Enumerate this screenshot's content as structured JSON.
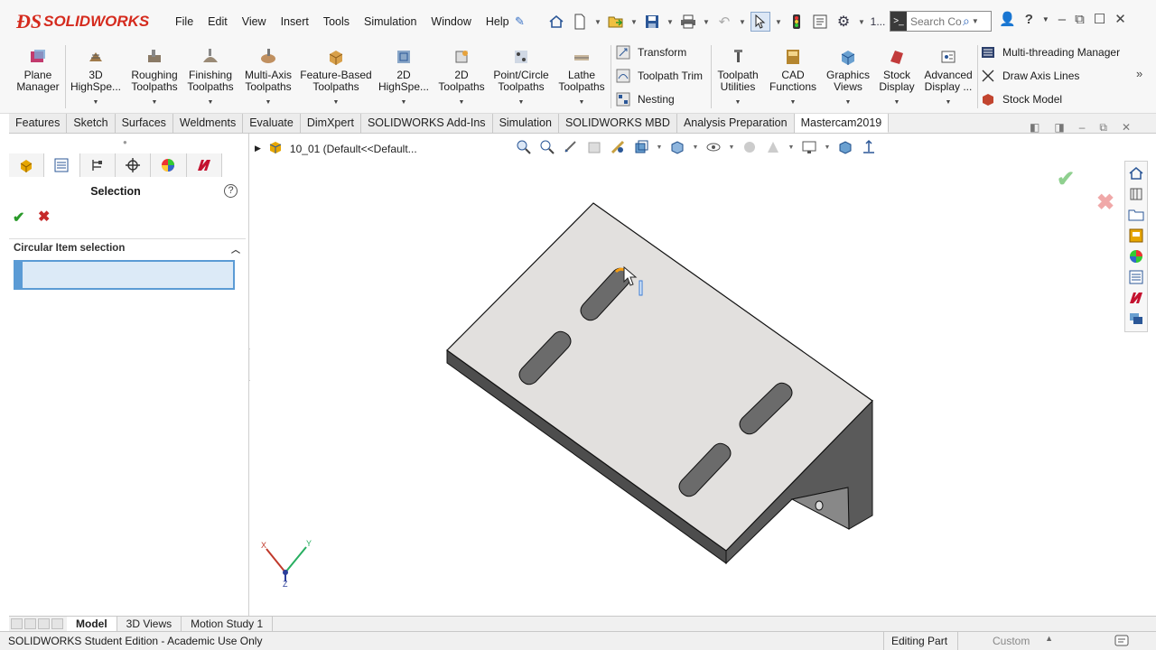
{
  "app": {
    "logo_text": "SOLIDWORKS",
    "menu": [
      "File",
      "Edit",
      "View",
      "Insert",
      "Tools",
      "Simulation",
      "Window",
      "Help"
    ],
    "search_placeholder": "Search Co",
    "rebuild_count": "1..."
  },
  "command_manager": {
    "plane_manager": "Plane Manager",
    "buttons": [
      {
        "label": "3D HighSpe...",
        "icon": "3d-highspeed-icon"
      },
      {
        "label": "Roughing Toolpaths",
        "icon": "roughing-icon"
      },
      {
        "label": "Finishing Toolpaths",
        "icon": "finishing-icon"
      },
      {
        "label": "Multi-Axis Toolpaths",
        "icon": "multiaxis-icon"
      },
      {
        "label": "Feature-Based Toolpaths",
        "icon": "feature-based-icon"
      },
      {
        "label": "2D HighSpe...",
        "icon": "2d-highspeed-icon"
      },
      {
        "label": "2D Toolpaths",
        "icon": "2d-toolpaths-icon"
      },
      {
        "label": "Point/Circle Toolpaths",
        "icon": "point-circle-icon"
      },
      {
        "label": "Lathe Toolpaths",
        "icon": "lathe-icon"
      }
    ],
    "stack": [
      "Transform",
      "Toolpath Trim",
      "Nesting"
    ],
    "buttons2": [
      {
        "label": "Toolpath Utilities",
        "icon": "toolpath-utilities-icon"
      },
      {
        "label": "CAD Functions",
        "icon": "cad-functions-icon"
      },
      {
        "label": "Graphics Views",
        "icon": "graphics-views-icon"
      },
      {
        "label": "Stock Display",
        "icon": "stock-display-icon"
      },
      {
        "label": "Advanced Display ...",
        "icon": "advanced-display-icon"
      }
    ],
    "stack2": [
      "Multi-threading Manager",
      "Draw Axis Lines",
      "Stock Model"
    ]
  },
  "tabs": [
    "Features",
    "Sketch",
    "Surfaces",
    "Weldments",
    "Evaluate",
    "DimXpert",
    "SOLIDWORKS Add-Ins",
    "Simulation",
    "SOLIDWORKS MBD",
    "Analysis Preparation",
    "Mastercam2019"
  ],
  "active_tab": "Mastercam2019",
  "property_manager": {
    "title": "Selection",
    "group_title": "Circular Item selection",
    "selection_value": ""
  },
  "graphics": {
    "tree_node": "10_01  (Default<<Default...",
    "triad": {
      "x": "X",
      "y": "Y",
      "z": "Z"
    },
    "colors": {
      "top_face": "#e2e0de",
      "side_face": "#6e6e6e",
      "front_face": "#4d4d4d",
      "highlight": "#f39c12"
    }
  },
  "bottom_tabs": [
    "Model",
    "3D Views",
    "Motion Study 1"
  ],
  "status": {
    "text": "SOLIDWORKS Student Edition - Academic Use Only",
    "mode": "Editing Part",
    "units": "Custom"
  }
}
